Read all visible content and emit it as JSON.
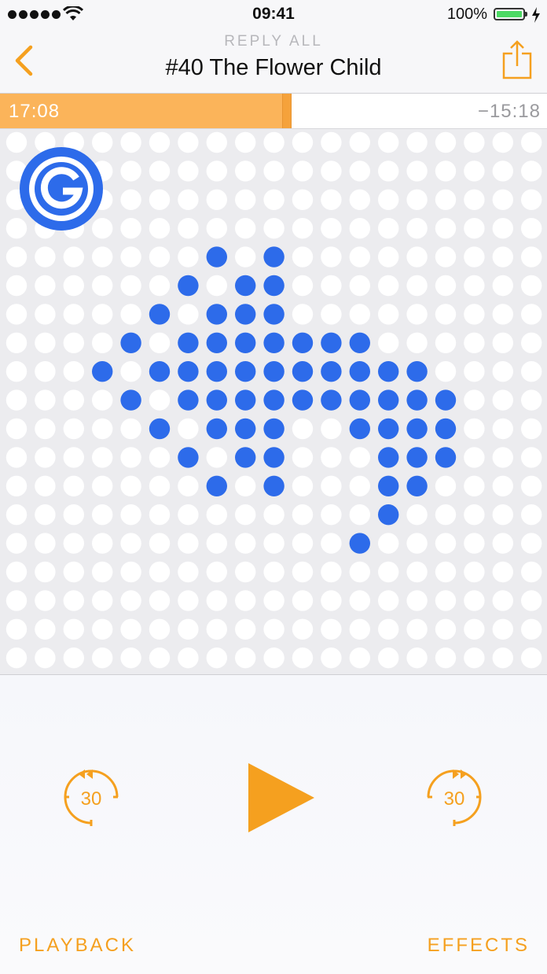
{
  "status_bar": {
    "time": "09:41",
    "battery_percent": "100%",
    "battery_level": 1.0,
    "signal_bars": 5
  },
  "nav": {
    "podcast_name": "REPLY ALL",
    "episode_title": "#40 The Flower Child",
    "back_icon": "chevron-left-icon",
    "share_icon": "share-icon"
  },
  "scrubber": {
    "elapsed": "17:08",
    "remaining": "−15:18",
    "progress": 0.528
  },
  "artwork": {
    "logo_letter": "G",
    "dot_color": "#2d6bea",
    "empty_dot_color": "#ffffff",
    "grid_columns": 19,
    "grid_rows": 19,
    "filled_dots": [
      [
        7,
        4
      ],
      [
        9,
        4
      ],
      [
        6,
        5
      ],
      [
        8,
        5
      ],
      [
        9,
        5
      ],
      [
        5,
        6
      ],
      [
        7,
        6
      ],
      [
        8,
        6
      ],
      [
        9,
        6
      ],
      [
        4,
        7
      ],
      [
        6,
        7
      ],
      [
        7,
        7
      ],
      [
        8,
        7
      ],
      [
        9,
        7
      ],
      [
        10,
        7
      ],
      [
        11,
        7
      ],
      [
        12,
        7
      ],
      [
        3,
        8
      ],
      [
        5,
        8
      ],
      [
        6,
        8
      ],
      [
        7,
        8
      ],
      [
        8,
        8
      ],
      [
        9,
        8
      ],
      [
        10,
        8
      ],
      [
        11,
        8
      ],
      [
        12,
        8
      ],
      [
        13,
        8
      ],
      [
        14,
        8
      ],
      [
        4,
        9
      ],
      [
        6,
        9
      ],
      [
        7,
        9
      ],
      [
        8,
        9
      ],
      [
        9,
        9
      ],
      [
        10,
        9
      ],
      [
        11,
        9
      ],
      [
        12,
        9
      ],
      [
        13,
        9
      ],
      [
        14,
        9
      ],
      [
        15,
        9
      ],
      [
        5,
        10
      ],
      [
        7,
        10
      ],
      [
        8,
        10
      ],
      [
        9,
        10
      ],
      [
        12,
        10
      ],
      [
        13,
        10
      ],
      [
        14,
        10
      ],
      [
        15,
        10
      ],
      [
        6,
        11
      ],
      [
        8,
        11
      ],
      [
        9,
        11
      ],
      [
        13,
        11
      ],
      [
        14,
        11
      ],
      [
        15,
        11
      ],
      [
        7,
        12
      ],
      [
        9,
        12
      ],
      [
        13,
        12
      ],
      [
        14,
        12
      ],
      [
        13,
        13
      ],
      [
        12,
        14
      ]
    ]
  },
  "controls": {
    "skip_back_label": "30",
    "skip_forward_label": "30",
    "playback_label": "PLAYBACK",
    "effects_label": "EFFECTS",
    "accent_color": "#f5a01f"
  }
}
